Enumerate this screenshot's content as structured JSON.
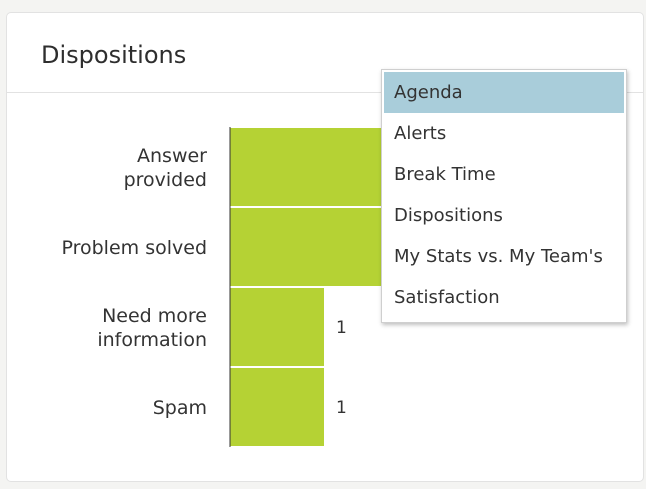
{
  "widget": {
    "title": "Dispositions"
  },
  "chart_data": {
    "type": "bar",
    "orientation": "horizontal",
    "categories": [
      [
        "Answer",
        "provided"
      ],
      [
        "Problem solved"
      ],
      [
        "Need more",
        "information"
      ],
      [
        "Spam"
      ]
    ],
    "values": [
      2,
      2,
      1,
      1
    ],
    "data_labels": [
      "",
      "",
      "1",
      "1"
    ],
    "colors": {
      "bar": "#b5d234",
      "axis": "#333333"
    },
    "title": "",
    "xlabel": "",
    "ylabel": ""
  },
  "dropdown": {
    "selected_index": 0,
    "highlight_color": "#a9cdda",
    "items": [
      {
        "label": "Agenda"
      },
      {
        "label": "Alerts"
      },
      {
        "label": "Break Time"
      },
      {
        "label": "Dispositions"
      },
      {
        "label": "My Stats vs. My Team's"
      },
      {
        "label": "Satisfaction"
      }
    ]
  }
}
